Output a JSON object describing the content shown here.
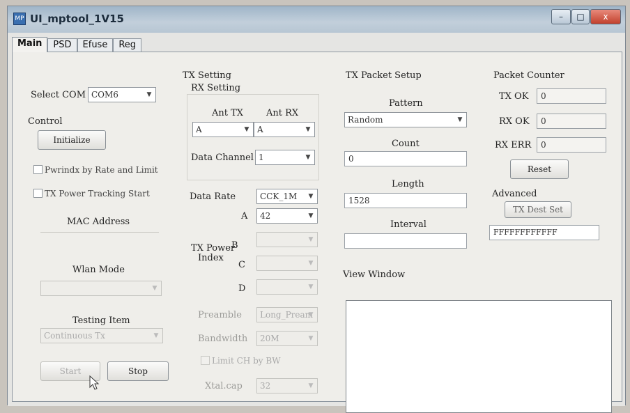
{
  "window": {
    "title": "UI_mptool_1V15",
    "app_icon_text": "MP",
    "controls": {
      "minimize": "–",
      "maximize": "□",
      "close": "x"
    }
  },
  "tabs": [
    "Main",
    "PSD",
    "Efuse",
    "Reg"
  ],
  "left": {
    "select_com_label": "Select COM",
    "com_value": "COM6",
    "control_label": "Control",
    "initialize_button": "Initialize",
    "pwrindx_checkbox": "Pwrindx by Rate and Limit",
    "tracking_checkbox": "TX Power Tracking Start",
    "mac_address_label": "MAC Address",
    "wlan_mode_label": "Wlan Mode",
    "wlan_mode_value": "",
    "testing_item_label": "Testing Item",
    "testing_item_value": "Continuous Tx",
    "start_button": "Start",
    "stop_button": "Stop"
  },
  "tx_setting": {
    "title": "TX Setting",
    "rx_setting_label": "RX Setting",
    "ant_tx_label": "Ant TX",
    "ant_rx_label": "Ant RX",
    "ant_tx_value": "A",
    "ant_rx_value": "A",
    "data_channel_label": "Data Channel",
    "data_channel_value": "1",
    "data_rate_label": "Data Rate",
    "data_rate_value": "CCK_1M",
    "power_index_label_1": "TX Power",
    "power_index_label_2": "Index",
    "path_a_label": "A",
    "path_a_value": "42",
    "path_b_label": "B",
    "path_c_label": "C",
    "path_d_label": "D",
    "preamble_label": "Preamble",
    "preamble_value": "Long_Pream",
    "bandwidth_label": "Bandwidth",
    "bandwidth_value": "20M",
    "limit_ch_checkbox": "Limit CH by BW",
    "xtal_cap_label": "Xtal.cap",
    "xtal_cap_value": "32"
  },
  "packet_setup": {
    "title": "TX Packet Setup",
    "pattern_label": "Pattern",
    "pattern_value": "Random",
    "count_label": "Count",
    "count_value": "0",
    "length_label": "Length",
    "length_value": "1528",
    "interval_label": "Interval",
    "interval_value": ""
  },
  "counter": {
    "title": "Packet Counter",
    "tx_ok_label": "TX OK",
    "tx_ok_value": "0",
    "rx_ok_label": "RX OK",
    "rx_ok_value": "0",
    "rx_err_label": "RX ERR",
    "rx_err_value": "0",
    "reset_button": "Reset"
  },
  "advanced": {
    "title": "Advanced",
    "tx_dest_set_button": "TX Dest Set",
    "dest_value": "FFFFFFFFFFFF"
  },
  "view_window_label": "View Window",
  "icons": {
    "dropdown": "▼"
  }
}
